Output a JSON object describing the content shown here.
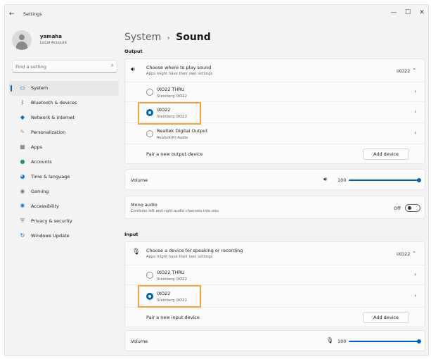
{
  "window": {
    "title": "Settings",
    "controls": {
      "minimize": "—",
      "maximize": "☐",
      "close": "✕"
    }
  },
  "account": {
    "name": "yamaha",
    "type": "Local Account"
  },
  "search": {
    "placeholder": "Find a setting"
  },
  "sidebar": {
    "items": [
      {
        "label": "System",
        "icon": "system-icon",
        "color": "#005fb8",
        "active": true
      },
      {
        "label": "Bluetooth & devices",
        "icon": "bluetooth-icon",
        "color": "#0067c0"
      },
      {
        "label": "Network & internet",
        "icon": "wifi-icon",
        "color": "#0067c0"
      },
      {
        "label": "Personalization",
        "icon": "brush-icon",
        "color": "#e8833a"
      },
      {
        "label": "Apps",
        "icon": "apps-icon",
        "color": "#5a6e8c"
      },
      {
        "label": "Accounts",
        "icon": "person-icon",
        "color": "#1f9e5a"
      },
      {
        "label": "Time & language",
        "icon": "globe-icon",
        "color": "#0f7fc7"
      },
      {
        "label": "Gaming",
        "icon": "gamepad-icon",
        "color": "#7a7a7a"
      },
      {
        "label": "Accessibility",
        "icon": "accessibility-icon",
        "color": "#1d6fd1"
      },
      {
        "label": "Privacy & security",
        "icon": "shield-icon",
        "color": "#7a7a7a"
      },
      {
        "label": "Windows Update",
        "icon": "update-icon",
        "color": "#0067c0"
      }
    ]
  },
  "breadcrumb": {
    "parent": "System",
    "separator": "›",
    "current": "Sound"
  },
  "output": {
    "section": "Output",
    "header": {
      "title": "Choose where to play sound",
      "subtitle": "Apps might have their own settings",
      "value": "IXO22"
    },
    "devices": [
      {
        "name": "IXO22 THRU",
        "detail": "Steinberg IXO22",
        "selected": false
      },
      {
        "name": "IXO22",
        "detail": "Steinberg IXO22",
        "selected": true
      },
      {
        "name": "Realtek Digital Output",
        "detail": "Realtek(R) Audio",
        "selected": false
      }
    ],
    "pair_label": "Pair a new output device",
    "add_button": "Add device"
  },
  "volume_output": {
    "label": "Volume",
    "value": "100",
    "level": 1.0
  },
  "mono": {
    "title": "Mono audio",
    "subtitle": "Combine left and right audio channels into one",
    "state": "Off"
  },
  "input": {
    "section": "Input",
    "header": {
      "title": "Choose a device for speaking or recording",
      "subtitle": "Apps might have their own settings",
      "value": "IXO22"
    },
    "devices": [
      {
        "name": "IXO22 THRU",
        "detail": "Steinberg IXO22",
        "selected": false
      },
      {
        "name": "IXO22",
        "detail": "Steinberg IXO22",
        "selected": true
      }
    ],
    "pair_label": "Pair a new input device",
    "add_button": "Add device"
  },
  "volume_input": {
    "label": "Volume",
    "value": "100",
    "level": 1.0
  },
  "colors": {
    "accent": "#005fb8",
    "highlight": "#f7a23a"
  }
}
